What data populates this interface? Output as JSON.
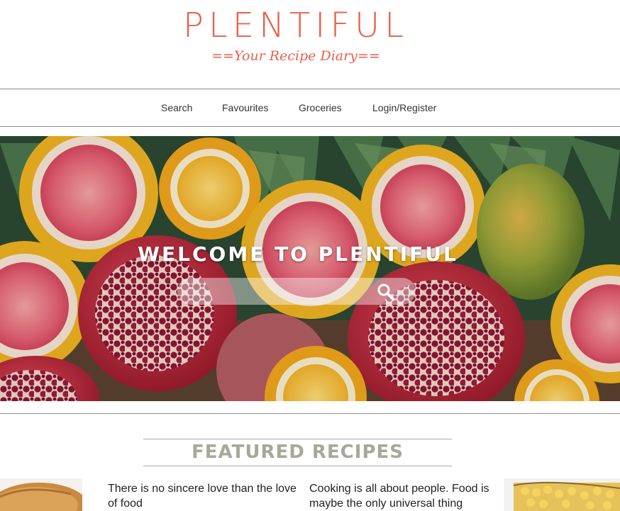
{
  "brand": {
    "title": "PLENTIFUL",
    "tagline": "==Your Recipe Diary==",
    "color": "#e8604c"
  },
  "nav": {
    "items": [
      {
        "label": "Search"
      },
      {
        "label": "Favourites"
      },
      {
        "label": "Groceries"
      },
      {
        "label": "Login/Register"
      }
    ]
  },
  "hero": {
    "title": "WELCOME TO PLENTIFUL",
    "search_icon": "search-icon",
    "background": "fruit-photo"
  },
  "featured": {
    "title": "FEATURED RECIPES",
    "title_color": "#a8a89a",
    "cards": [
      {
        "quote": "There is no sincere love than the love of food"
      },
      {
        "quote": "Cooking is all about people. Food is maybe the only universal thing"
      }
    ]
  }
}
